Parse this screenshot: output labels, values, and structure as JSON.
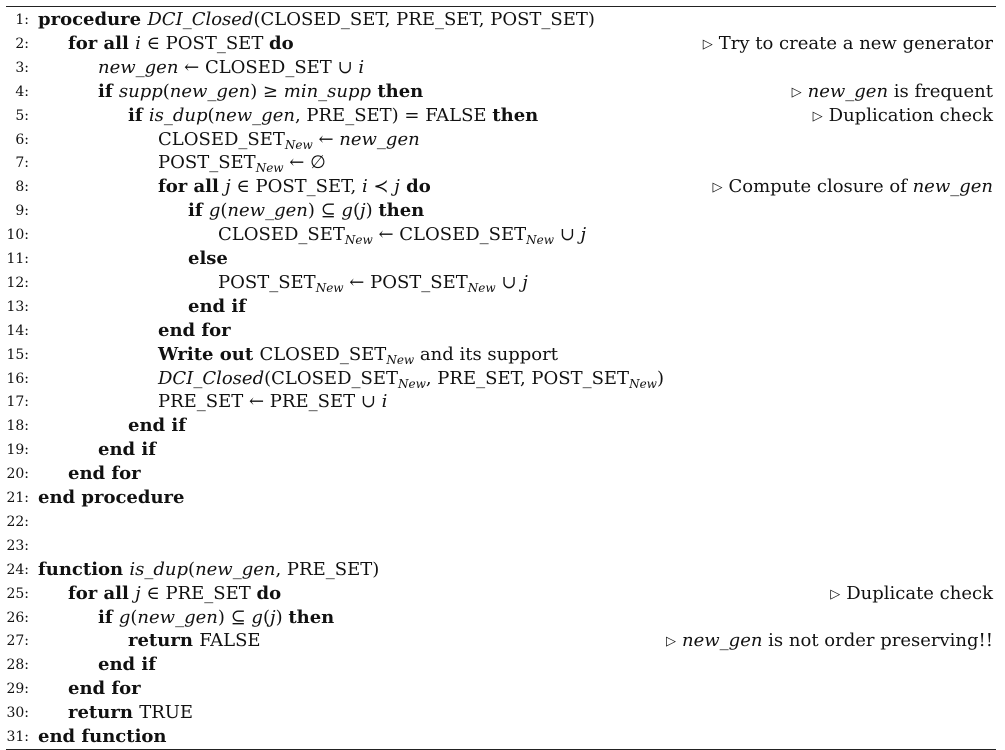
{
  "lines": [
    {
      "n": "1:",
      "indent": 0,
      "segs": [
        [
          "kw",
          "procedure "
        ],
        [
          "it",
          "DCI_Closed"
        ],
        [
          "t",
          "(CLOSED_SET, PRE_SET, POST_SET)"
        ]
      ]
    },
    {
      "n": "2:",
      "indent": 1,
      "segs": [
        [
          "kw",
          "for all "
        ],
        [
          "it",
          "i"
        ],
        [
          "t",
          " ∈ POST_SET "
        ],
        [
          "kw",
          "do"
        ]
      ],
      "comment": [
        [
          "t",
          "Try to create a new generator"
        ]
      ]
    },
    {
      "n": "3:",
      "indent": 2,
      "segs": [
        [
          "it",
          "new_gen"
        ],
        [
          "t",
          " ← CLOSED_SET ∪ "
        ],
        [
          "it",
          "i"
        ]
      ]
    },
    {
      "n": "4:",
      "indent": 2,
      "segs": [
        [
          "kw",
          "if "
        ],
        [
          "it",
          "supp"
        ],
        [
          "t",
          "("
        ],
        [
          "it",
          "new_gen"
        ],
        [
          "t",
          ") ≥ "
        ],
        [
          "it",
          "min_supp"
        ],
        [
          "kw",
          " then"
        ]
      ],
      "comment": [
        [
          "it",
          "new_gen"
        ],
        [
          "t",
          " is frequent"
        ]
      ]
    },
    {
      "n": "5:",
      "indent": 3,
      "segs": [
        [
          "kw",
          "if "
        ],
        [
          "it",
          "is_dup"
        ],
        [
          "t",
          "("
        ],
        [
          "it",
          "new_gen"
        ],
        [
          "t",
          ", PRE_SET) = FALSE "
        ],
        [
          "kw",
          "then"
        ]
      ],
      "comment": [
        [
          "t",
          "Duplication check"
        ]
      ]
    },
    {
      "n": "6:",
      "indent": 4,
      "segs": [
        [
          "t",
          "CLOSED_SET"
        ],
        [
          "sub",
          "New"
        ],
        [
          "t",
          " ← "
        ],
        [
          "it",
          "new_gen"
        ]
      ]
    },
    {
      "n": "7:",
      "indent": 4,
      "segs": [
        [
          "t",
          "POST_SET"
        ],
        [
          "sub",
          "New"
        ],
        [
          "t",
          " ← ∅"
        ]
      ]
    },
    {
      "n": "8:",
      "indent": 4,
      "segs": [
        [
          "kw",
          "for all "
        ],
        [
          "it",
          "j"
        ],
        [
          "t",
          " ∈ POST_SET,  "
        ],
        [
          "it",
          "i"
        ],
        [
          "t",
          " ≺ "
        ],
        [
          "it",
          "j"
        ],
        [
          "kw",
          "  do"
        ]
      ],
      "comment": [
        [
          "t",
          "Compute closure of "
        ],
        [
          "it",
          "new_gen"
        ]
      ]
    },
    {
      "n": "9:",
      "indent": 5,
      "segs": [
        [
          "kw",
          "if "
        ],
        [
          "it",
          "g"
        ],
        [
          "t",
          "("
        ],
        [
          "it",
          "new_gen"
        ],
        [
          "t",
          ") ⊆ "
        ],
        [
          "it",
          "g"
        ],
        [
          "t",
          "("
        ],
        [
          "it",
          "j"
        ],
        [
          "t",
          ") "
        ],
        [
          "kw",
          "then"
        ]
      ]
    },
    {
      "n": "10:",
      "indent": 6,
      "segs": [
        [
          "t",
          "CLOSED_SET"
        ],
        [
          "sub",
          "New"
        ],
        [
          "t",
          " ← CLOSED_SET"
        ],
        [
          "sub",
          "New"
        ],
        [
          "t",
          " ∪ "
        ],
        [
          "it",
          "j"
        ]
      ]
    },
    {
      "n": "11:",
      "indent": 5,
      "segs": [
        [
          "kw",
          "else"
        ]
      ]
    },
    {
      "n": "12:",
      "indent": 6,
      "segs": [
        [
          "t",
          "POST_SET"
        ],
        [
          "sub",
          "New"
        ],
        [
          "t",
          " ← POST_SET"
        ],
        [
          "sub",
          "New"
        ],
        [
          "t",
          " ∪  "
        ],
        [
          "it",
          "j"
        ]
      ]
    },
    {
      "n": "13:",
      "indent": 5,
      "segs": [
        [
          "kw",
          "end if"
        ]
      ]
    },
    {
      "n": "14:",
      "indent": 4,
      "segs": [
        [
          "kw",
          "end for"
        ]
      ]
    },
    {
      "n": "15:",
      "indent": 4,
      "segs": [
        [
          "kw",
          "Write out "
        ],
        [
          "t",
          "CLOSED_SET"
        ],
        [
          "sub",
          "New"
        ],
        [
          "t",
          " and its support"
        ]
      ]
    },
    {
      "n": "16:",
      "indent": 4,
      "segs": [
        [
          "it",
          "DCI_Closed"
        ],
        [
          "t",
          "(CLOSED_SET"
        ],
        [
          "sub",
          "New"
        ],
        [
          "t",
          ", PRE_SET, POST_SET"
        ],
        [
          "sub",
          "New"
        ],
        [
          "t",
          ")"
        ]
      ]
    },
    {
      "n": "17:",
      "indent": 4,
      "segs": [
        [
          "t",
          "PRE_SET ← PRE_SET ∪ "
        ],
        [
          "it",
          "i"
        ]
      ]
    },
    {
      "n": "18:",
      "indent": 3,
      "segs": [
        [
          "kw",
          "end if"
        ]
      ]
    },
    {
      "n": "19:",
      "indent": 2,
      "segs": [
        [
          "kw",
          "end if"
        ]
      ]
    },
    {
      "n": "20:",
      "indent": 1,
      "segs": [
        [
          "kw",
          "end for"
        ]
      ]
    },
    {
      "n": "21:",
      "indent": 0,
      "segs": [
        [
          "kw",
          "end procedure"
        ]
      ]
    },
    {
      "n": "22:",
      "indent": 0,
      "segs": []
    },
    {
      "n": "23:",
      "indent": 0,
      "segs": []
    },
    {
      "n": "24:",
      "indent": 0,
      "segs": [
        [
          "kw",
          "function "
        ],
        [
          "it",
          "is_dup"
        ],
        [
          "t",
          "("
        ],
        [
          "it",
          "new_gen"
        ],
        [
          "t",
          ", PRE_SET)"
        ]
      ]
    },
    {
      "n": "25:",
      "indent": 1,
      "segs": [
        [
          "kw",
          "for all "
        ],
        [
          "it",
          "j"
        ],
        [
          "t",
          " ∈ PRE_SET "
        ],
        [
          "kw",
          "do"
        ]
      ],
      "comment": [
        [
          "t",
          "Duplicate check"
        ]
      ]
    },
    {
      "n": "26:",
      "indent": 2,
      "segs": [
        [
          "kw",
          "if "
        ],
        [
          "it",
          "g"
        ],
        [
          "t",
          "("
        ],
        [
          "it",
          "new_gen"
        ],
        [
          "t",
          ") ⊆ "
        ],
        [
          "it",
          "g"
        ],
        [
          "t",
          "("
        ],
        [
          "it",
          "j"
        ],
        [
          "t",
          ") "
        ],
        [
          "kw",
          "then"
        ]
      ]
    },
    {
      "n": "27:",
      "indent": 3,
      "segs": [
        [
          "kw",
          "return "
        ],
        [
          "t",
          "FALSE"
        ]
      ],
      "comment": [
        [
          "it",
          "new_gen"
        ],
        [
          "t",
          " is not order preserving!!"
        ]
      ]
    },
    {
      "n": "28:",
      "indent": 2,
      "segs": [
        [
          "kw",
          "end if"
        ]
      ]
    },
    {
      "n": "29:",
      "indent": 1,
      "segs": [
        [
          "kw",
          "end for"
        ]
      ]
    },
    {
      "n": "30:",
      "indent": 1,
      "segs": [
        [
          "kw",
          "return "
        ],
        [
          "t",
          "TRUE"
        ]
      ]
    },
    {
      "n": "31:",
      "indent": 0,
      "segs": [
        [
          "kw",
          "end function"
        ]
      ]
    }
  ]
}
